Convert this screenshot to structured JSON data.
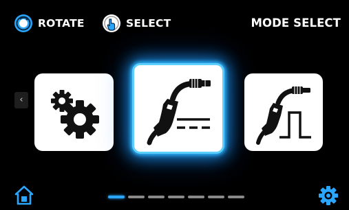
{
  "header": {
    "rotate_hint": "ROTATE",
    "select_hint": "SELECT",
    "title": "MODE SELECT"
  },
  "modes": [
    {
      "id": "settings",
      "icon": "gears-icon",
      "selected": false
    },
    {
      "id": "mig",
      "icon": "mig-torch-icon",
      "selected": true
    },
    {
      "id": "pulse",
      "icon": "pulse-torch-icon",
      "selected": false
    }
  ],
  "navigation": {
    "prev_arrow": "‹"
  },
  "pager": {
    "page_count": 7,
    "current_page": 1
  },
  "colors": {
    "accent": "#2aa6ff",
    "background": "#000000",
    "card": "#ffffff"
  }
}
